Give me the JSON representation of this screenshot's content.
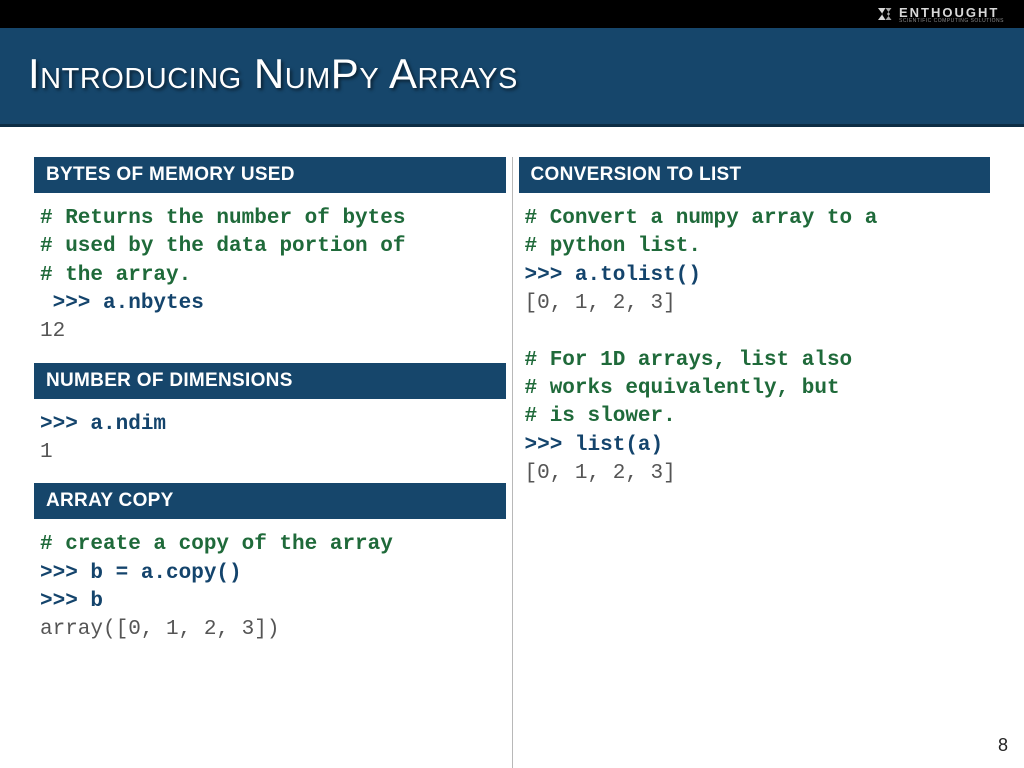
{
  "brand": {
    "name": "ENTHOUGHT",
    "tagline": "SCIENTIFIC COMPUTING SOLUTIONS"
  },
  "title": "Introducing NumPy Arrays",
  "page_number": "8",
  "left": {
    "sec1": {
      "header": "BYTES OF MEMORY USED",
      "c1": "# Returns the number of bytes",
      "c2": "# used by the data portion of",
      "c3": "# the array.",
      "p1": " >>> a.nbytes",
      "o1": "12"
    },
    "sec2": {
      "header": "NUMBER OF DIMENSIONS",
      "p1": ">>> a.ndim",
      "o1": "1"
    },
    "sec3": {
      "header": "ARRAY COPY",
      "c1": "# create a copy of the array",
      "p1": ">>> b = a.copy()",
      "p2": ">>> b",
      "o1": "array([0, 1, 2, 3])"
    }
  },
  "right": {
    "sec1": {
      "header": "CONVERSION TO LIST",
      "c1": "# Convert a numpy array to a",
      "c2": "# python list.",
      "p1": ">>> a.tolist()",
      "o1": "[0, 1, 2, 3]",
      "c3": "# For 1D arrays, list also",
      "c4": "# works equivalently, but",
      "c5": "# is slower.",
      "p2": ">>> list(a)",
      "o2": "[0, 1, 2, 3]"
    }
  }
}
